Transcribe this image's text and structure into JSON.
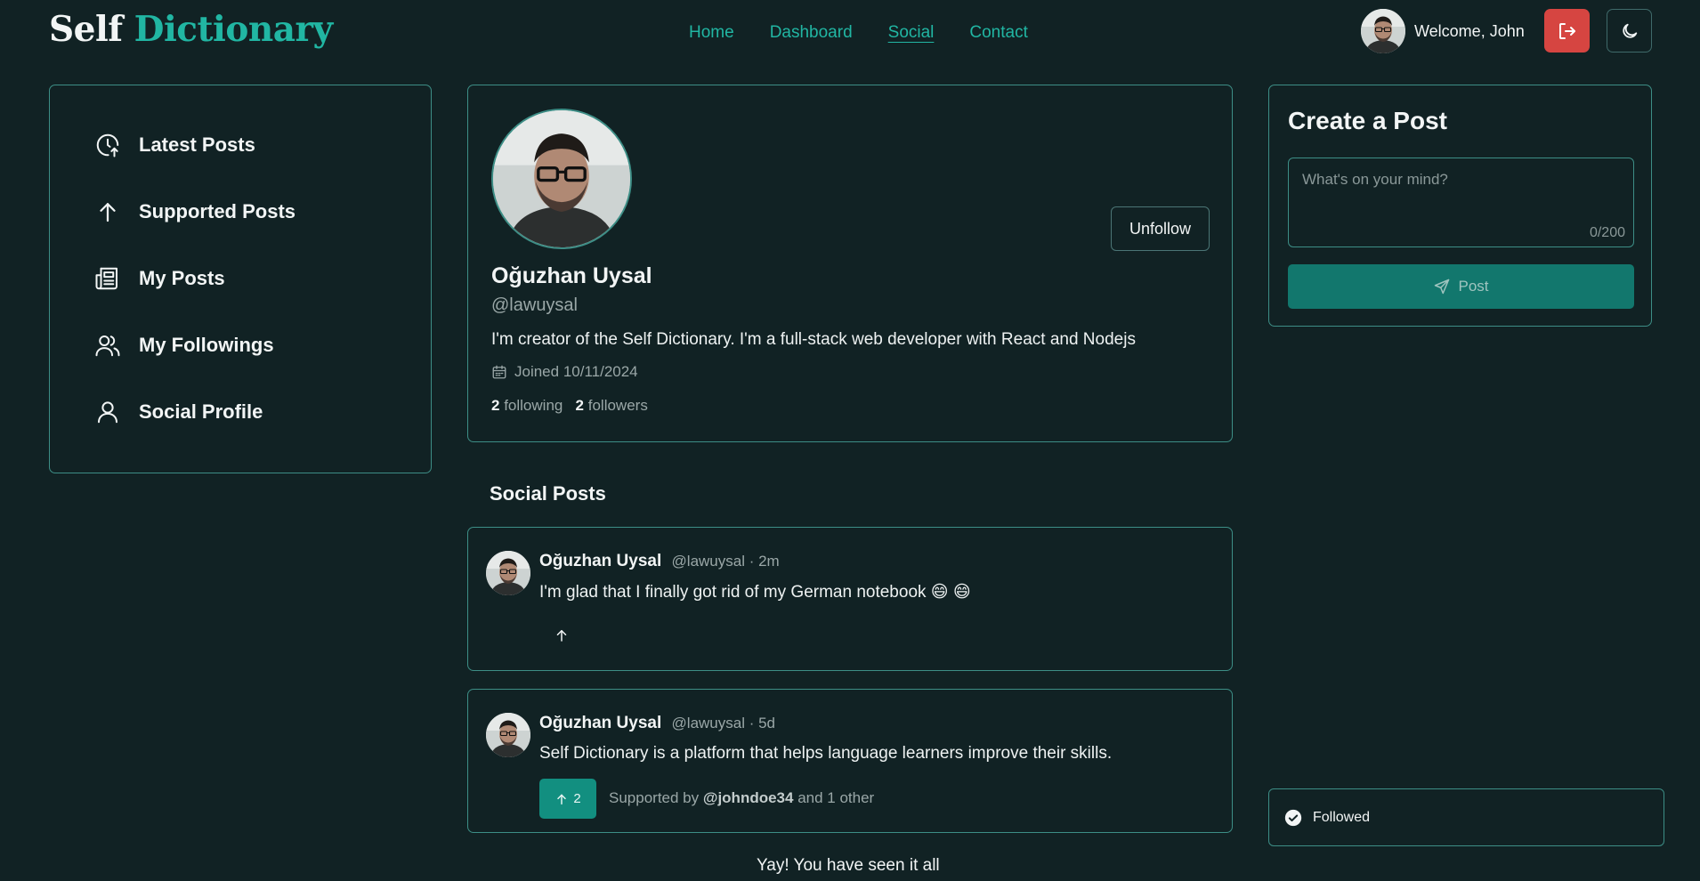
{
  "header": {
    "logo_word1": "Self",
    "logo_word2": "Dictionary",
    "nav": [
      {
        "label": "Home",
        "active": false
      },
      {
        "label": "Dashboard",
        "active": false
      },
      {
        "label": "Social",
        "active": true
      },
      {
        "label": "Contact",
        "active": false
      }
    ],
    "welcome_text": "Welcome, John",
    "logout_icon": "logout-icon",
    "theme_icon": "moon-icon"
  },
  "sidebar": {
    "items": [
      {
        "label": "Latest Posts",
        "icon": "clock-arrow-icon"
      },
      {
        "label": "Supported Posts",
        "icon": "arrow-up-icon"
      },
      {
        "label": "My Posts",
        "icon": "newspaper-icon"
      },
      {
        "label": "My Followings",
        "icon": "users-icon"
      },
      {
        "label": "Social Profile",
        "icon": "user-icon"
      }
    ]
  },
  "profile": {
    "name": "Oğuzhan Uysal",
    "handle": "@lawuysal",
    "bio": "I'm creator of the Self Dictionary. I'm a full-stack web developer with React and Nodejs",
    "joined": "Joined 10/11/2024",
    "following_count": "2",
    "following_label": "following",
    "followers_count": "2",
    "followers_label": "followers",
    "unfollow_label": "Unfollow"
  },
  "posts_section_title": "Social Posts",
  "posts": [
    {
      "name": "Oğuzhan Uysal",
      "meta": "@lawuysal · 2m",
      "text": "I'm glad that I finally got rid of my German notebook 😄 😄",
      "support_count": null,
      "supported_prefix": null,
      "supported_user": null,
      "supported_suffix": null
    },
    {
      "name": "Oğuzhan Uysal",
      "meta": "@lawuysal · 5d",
      "text": "Self Dictionary is a platform that helps language learners improve their skills.",
      "support_count": "2",
      "supported_prefix": "Supported by",
      "supported_user": "@johndoe34",
      "supported_suffix": "and 1 other"
    }
  ],
  "end_message": "Yay! You have seen it all",
  "create_post": {
    "title": "Create a Post",
    "placeholder": "What's on your mind?",
    "counter": "0/200",
    "button_label": "Post"
  },
  "toast": {
    "message": "Followed"
  },
  "colors": {
    "background": "#112224",
    "accent": "#21b6a3",
    "border": "#3d8e86",
    "danger": "#d64541",
    "support_button": "#128f80"
  }
}
